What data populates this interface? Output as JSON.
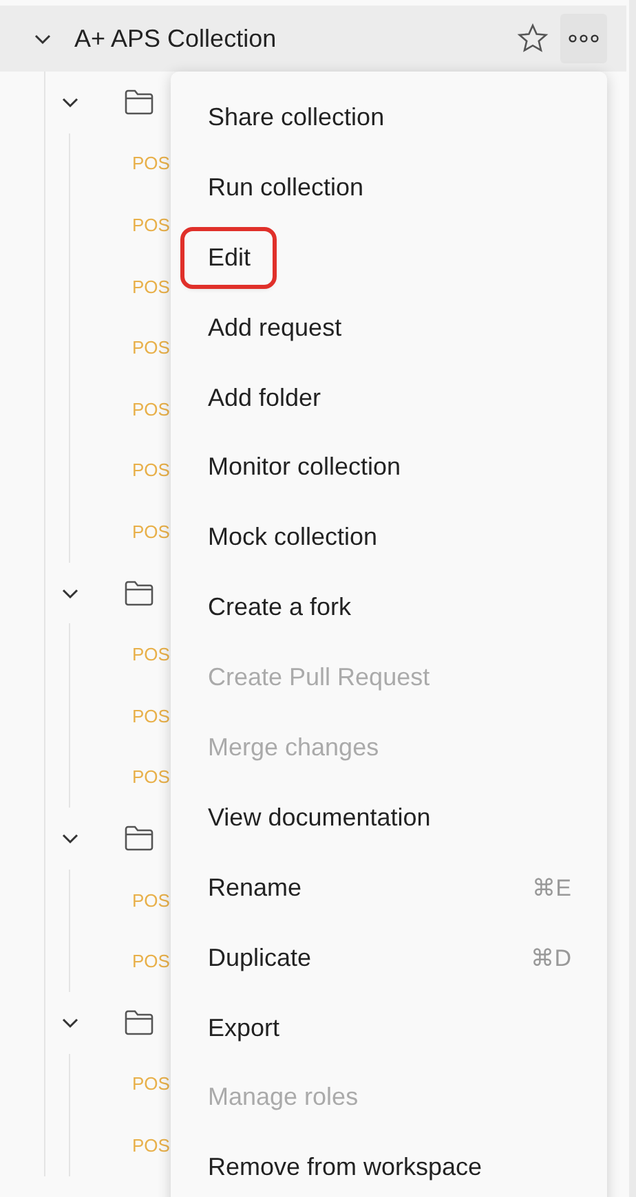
{
  "collection": {
    "name": "A+ APS Collection",
    "expanded": true,
    "starred": false
  },
  "tree": [
    {
      "kind": "folder",
      "expanded": true,
      "children": [
        {
          "method": "POS"
        },
        {
          "method": "POS"
        },
        {
          "method": "POS"
        },
        {
          "method": "POS"
        },
        {
          "method": "POS"
        },
        {
          "method": "POS"
        },
        {
          "method": "POS"
        }
      ]
    },
    {
      "kind": "folder",
      "expanded": true,
      "children": [
        {
          "method": "POS"
        },
        {
          "method": "POS"
        },
        {
          "method": "POS"
        }
      ]
    },
    {
      "kind": "folder",
      "expanded": true,
      "children": [
        {
          "method": "POS"
        },
        {
          "method": "POS"
        }
      ]
    },
    {
      "kind": "folder",
      "expanded": true,
      "children": [
        {
          "method": "POS"
        },
        {
          "method": "POS"
        }
      ]
    }
  ],
  "menu": [
    {
      "label": "Share collection",
      "disabled": false,
      "highlighted": false
    },
    {
      "label": "Run collection",
      "disabled": false,
      "highlighted": false
    },
    {
      "label": "Edit",
      "disabled": false,
      "highlighted": true
    },
    {
      "label": "Add request",
      "disabled": false,
      "highlighted": false
    },
    {
      "label": "Add folder",
      "disabled": false,
      "highlighted": false
    },
    {
      "label": "Monitor collection",
      "disabled": false,
      "highlighted": false
    },
    {
      "label": "Mock collection",
      "disabled": false,
      "highlighted": false
    },
    {
      "label": "Create a fork",
      "disabled": false,
      "highlighted": false
    },
    {
      "label": "Create Pull Request",
      "disabled": true,
      "highlighted": false
    },
    {
      "label": "Merge changes",
      "disabled": true,
      "highlighted": false
    },
    {
      "label": "View documentation",
      "disabled": false,
      "highlighted": false
    },
    {
      "label": "Rename",
      "shortcut": "⌘E",
      "disabled": false,
      "highlighted": false
    },
    {
      "label": "Duplicate",
      "shortcut": "⌘D",
      "disabled": false,
      "highlighted": false
    },
    {
      "label": "Export",
      "disabled": false,
      "highlighted": false
    },
    {
      "label": "Manage roles",
      "disabled": true,
      "highlighted": false
    },
    {
      "label": "Remove from workspace",
      "disabled": false,
      "highlighted": false
    }
  ]
}
